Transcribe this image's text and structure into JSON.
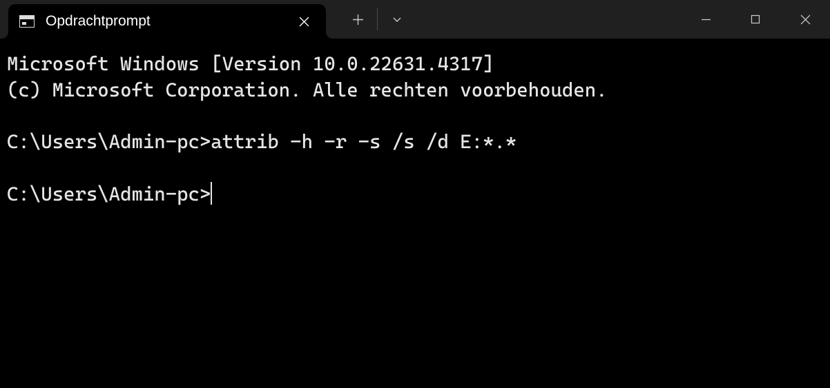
{
  "titlebar": {
    "tab_title": "Opdrachtprompt"
  },
  "terminal": {
    "line1": "Microsoft Windows [Version 10.0.22631.4317]",
    "line2": "(c) Microsoft Corporation. Alle rechten voorbehouden.",
    "blank1": "",
    "prompt1": "C:\\Users\\Admin-pc>",
    "cmd1": "attrib -h -r -s /s /d E:*.*",
    "blank2": "",
    "prompt2": "C:\\Users\\Admin-pc>"
  }
}
